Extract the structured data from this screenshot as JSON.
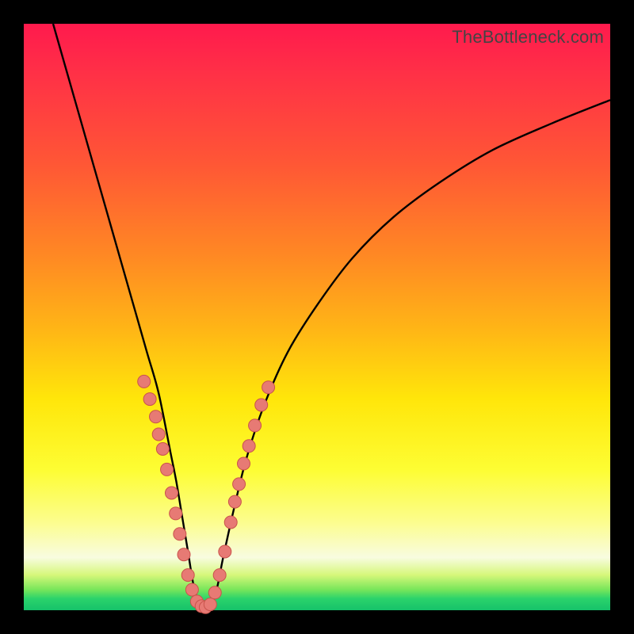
{
  "watermark": "TheBottleneck.com",
  "colors": {
    "curve": "#000000",
    "dot_fill": "#e77a74",
    "dot_stroke": "#c9534c",
    "frame": "#000000"
  },
  "chart_data": {
    "type": "line",
    "title": "",
    "xlabel": "",
    "ylabel": "",
    "xlim": [
      0,
      100
    ],
    "ylim": [
      0,
      100
    ],
    "series": [
      {
        "name": "bottleneck-curve",
        "x": [
          5,
          7,
          9,
          11,
          13,
          15,
          17,
          19,
          21,
          23,
          25,
          26,
          27,
          28,
          29,
          30,
          31,
          32,
          33,
          34,
          36,
          38,
          41,
          45,
          50,
          56,
          63,
          71,
          80,
          90,
          100
        ],
        "y": [
          100,
          93,
          86,
          79,
          72,
          65,
          58,
          51,
          44,
          37,
          27,
          22,
          16,
          10,
          4,
          1,
          0.5,
          1,
          4,
          9,
          18,
          26,
          35,
          44,
          52,
          60,
          67,
          73,
          78.5,
          83,
          87
        ]
      }
    ],
    "dots": {
      "name": "highlighted-points",
      "points": [
        {
          "x": 20.5,
          "y": 39
        },
        {
          "x": 21.5,
          "y": 36
        },
        {
          "x": 22.5,
          "y": 33
        },
        {
          "x": 23.0,
          "y": 30
        },
        {
          "x": 23.7,
          "y": 27.5
        },
        {
          "x": 24.4,
          "y": 24
        },
        {
          "x": 25.2,
          "y": 20
        },
        {
          "x": 25.9,
          "y": 16.5
        },
        {
          "x": 26.6,
          "y": 13
        },
        {
          "x": 27.3,
          "y": 9.5
        },
        {
          "x": 28.0,
          "y": 6
        },
        {
          "x": 28.7,
          "y": 3.5
        },
        {
          "x": 29.5,
          "y": 1.5
        },
        {
          "x": 30.3,
          "y": 0.7
        },
        {
          "x": 31.0,
          "y": 0.5
        },
        {
          "x": 31.8,
          "y": 1.0
        },
        {
          "x": 32.6,
          "y": 3.0
        },
        {
          "x": 33.4,
          "y": 6.0
        },
        {
          "x": 34.3,
          "y": 10.0
        },
        {
          "x": 35.3,
          "y": 15.0
        },
        {
          "x": 36.0,
          "y": 18.5
        },
        {
          "x": 36.7,
          "y": 21.5
        },
        {
          "x": 37.5,
          "y": 25.0
        },
        {
          "x": 38.4,
          "y": 28.0
        },
        {
          "x": 39.4,
          "y": 31.5
        },
        {
          "x": 40.5,
          "y": 35.0
        },
        {
          "x": 41.7,
          "y": 38.0
        }
      ],
      "radius": 8
    }
  }
}
